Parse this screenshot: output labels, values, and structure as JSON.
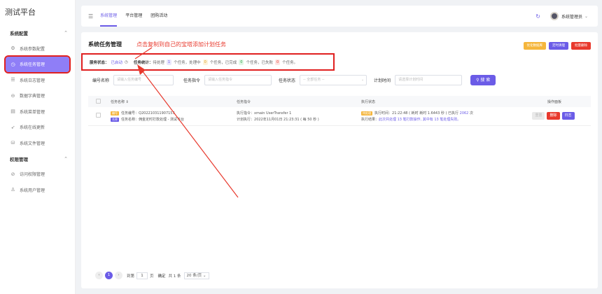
{
  "app": {
    "title": "测试平台"
  },
  "sidebar": {
    "groups": [
      {
        "label": "系统配置",
        "items": [
          {
            "label": "系统参数配置",
            "icon": "gear-icon",
            "glyph": "⚙"
          },
          {
            "label": "系统任务管理",
            "icon": "clock-icon",
            "glyph": "◷",
            "active": true
          },
          {
            "label": "系统日志管理",
            "icon": "log-icon",
            "glyph": "☰"
          },
          {
            "label": "数据字典管理",
            "icon": "dict-icon",
            "glyph": "⊖"
          },
          {
            "label": "系统菜单管理",
            "icon": "menu-icon",
            "glyph": "▤"
          },
          {
            "label": "系统在线更新",
            "icon": "send-icon",
            "glyph": "➶"
          },
          {
            "label": "系统文件管理",
            "icon": "database-icon",
            "glyph": "⛁"
          }
        ]
      },
      {
        "label": "权限管理",
        "items": [
          {
            "label": "访问权限管理",
            "icon": "shield-check-icon",
            "glyph": "⊘"
          },
          {
            "label": "系统用户管理",
            "icon": "user-icon",
            "glyph": "♙"
          }
        ]
      }
    ]
  },
  "header": {
    "tabs": [
      "系统管理",
      "平台管理",
      "团购活动"
    ],
    "active_tab": 0,
    "user_name": "系统管理员"
  },
  "page": {
    "title": "系统任务管理",
    "annotation": "点击复制到自己的宝塔添加计划任务",
    "top_buttons": [
      {
        "label": "优化数据库",
        "color": "#f5b63c"
      },
      {
        "label": "定时清理",
        "color": "#6b5ce7"
      },
      {
        "label": "批量删除",
        "color": "#e8392d"
      }
    ]
  },
  "status": {
    "label": "服务状态：",
    "running_text": "已启动",
    "stats_label": "任务统计：",
    "pending_prefix": "待处理",
    "pending": "1",
    "processing_prefix": "个任务，处理中",
    "processing": "0",
    "done_prefix": "个任务，已完成",
    "done": "0",
    "failed_prefix": "个任务，已失败",
    "failed": "0",
    "suffix": "个任务。"
  },
  "filters": {
    "code_label": "编号名称",
    "code_placeholder": "请输入任务编号",
    "cmd_label": "任务指令",
    "cmd_placeholder": "请输入任务指令",
    "status_label": "任务状态",
    "status_value": "-- 全部任务 --",
    "time_label": "计划时间",
    "time_placeholder": "请选择计划时间",
    "search_label": "搜 索"
  },
  "table": {
    "headers": [
      "任务名称 ⇕",
      "任务指令",
      "执行状态",
      "操作面板"
    ],
    "rows": [
      {
        "code_tag": "编号",
        "code_label": "任务编号：",
        "code": "Q202210311907153",
        "name_tag": "名称",
        "name_label": "任务名称：",
        "name": "佣金定时打款处理 - 测试平台",
        "cmd_label": "执行指令：",
        "cmd": "xmain UserTransfer 1",
        "plan_label": "计划执行：",
        "plan_time": "2022年11月01日 21:23:31",
        "plan_extra": "( 每 50 秒 )",
        "state_tag": "待处理",
        "exec_time_label": "执行时间：",
        "exec_time": "21:22:48",
        "exec_cost": "( 耗时 耗时 1.6443 秒 )",
        "exec_count_prefix": "已执行",
        "exec_count": "2062",
        "exec_count_suffix": "次",
        "result_label": "执行结果：",
        "result": "此次共处理 13 笔打款操作, 其中有 13 笔处理失败。",
        "actions": [
          {
            "label": "重置",
            "color": "#e9e9e9"
          },
          {
            "label": "删除",
            "color": "#e8392d"
          },
          {
            "label": "日志",
            "color": "#6b5ce7"
          }
        ]
      }
    ]
  },
  "pager": {
    "current": "1",
    "goto_label": "到第",
    "goto_value": "1",
    "page_label": "页",
    "confirm": "确定",
    "total": "共 1 条",
    "page_size": "20 条/页 ⌄"
  },
  "colors": {
    "accent": "#6b5ce7",
    "danger": "#e8392d",
    "warning": "#f5b63c"
  }
}
